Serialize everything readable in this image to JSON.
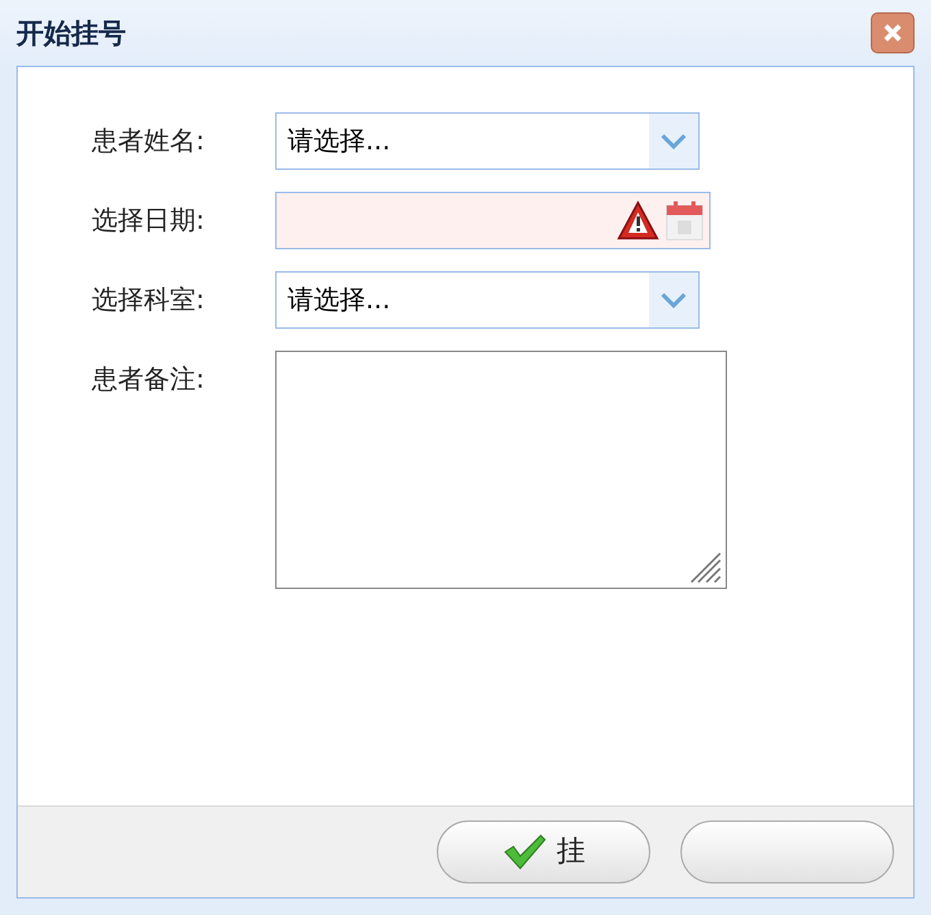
{
  "window": {
    "title": "开始挂号"
  },
  "fields": [
    {
      "kind": "combo",
      "label": "患者姓名:",
      "value": "请选择...",
      "invalid": false
    },
    {
      "kind": "date",
      "label": "选择日期:",
      "invalid": true
    },
    {
      "kind": "combo",
      "label": "选择科室:",
      "value": "请选择...",
      "invalid": false
    },
    {
      "kind": "textarea",
      "label": "患者备注:",
      "invalid": false
    }
  ],
  "buttons": [
    {
      "kind": "confirm",
      "label": "挂"
    },
    {
      "kind": "plain"
    }
  ]
}
